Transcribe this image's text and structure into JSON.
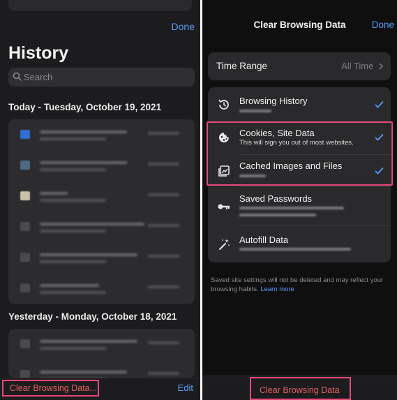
{
  "history": {
    "done_label": "Done",
    "title": "History",
    "search_placeholder": "Search",
    "today_header": "Today - Tuesday, October 19, 2021",
    "yesterday_header": "Yesterday - Monday, October 18, 2021",
    "clear_label": "Clear Browsing Data...",
    "edit_label": "Edit"
  },
  "clear_panel": {
    "title": "Clear Browsing Data",
    "done_label": "Done",
    "time_range_label": "Time Range",
    "time_range_value": "All Time",
    "items": [
      {
        "title": "Browsing History",
        "subtitle": "",
        "checked": true,
        "icon": "history-icon"
      },
      {
        "title": "Cookies, Site Data",
        "subtitle": "This will sign you out of most websites.",
        "checked": true,
        "icon": "cookie-icon"
      },
      {
        "title": "Cached Images and Files",
        "subtitle": "",
        "checked": true,
        "icon": "image-icon"
      },
      {
        "title": "Saved Passwords",
        "subtitle": "",
        "checked": false,
        "icon": "key-icon"
      },
      {
        "title": "Autofill Data",
        "subtitle": "",
        "checked": false,
        "icon": "magic-wand-icon"
      }
    ],
    "footer_text": "Saved site settings will not be deleted and may reflect your browsing habits.",
    "footer_link": "Learn more",
    "clear_button": "Clear Browsing Data"
  },
  "colors": {
    "accent": "#5a9cf8",
    "destructive": "#e8605f",
    "annotation": "#e8477a"
  }
}
